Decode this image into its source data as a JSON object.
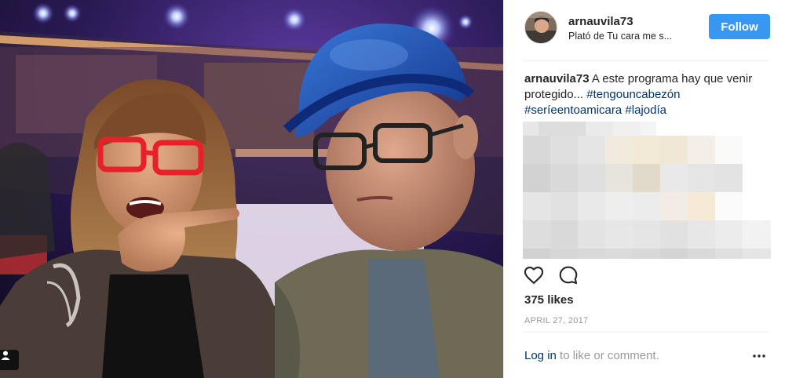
{
  "post": {
    "username": "arnauvila73",
    "location": "Plató de Tu cara me s...",
    "follow_label": "Follow",
    "caption": {
      "user": "arnauvila73",
      "text_before": " A este programa hay que venir protegido... ",
      "hashtags": [
        "#tengouncabezón",
        "#seríeentoamicara",
        "#lajodía"
      ]
    },
    "likes": "375 likes",
    "date": "APRIL 27, 2017",
    "login": {
      "link_text": "Log in",
      "rest_text": " to like or comment."
    }
  },
  "icons": {
    "like": "heart-icon",
    "comment": "comment-icon",
    "more": "more-options-icon",
    "user_tag": "user-tag-icon"
  },
  "colors": {
    "follow_button": "#3897f0",
    "hashtag": "#003569",
    "muted_text": "#999999",
    "divider": "#efefef"
  }
}
